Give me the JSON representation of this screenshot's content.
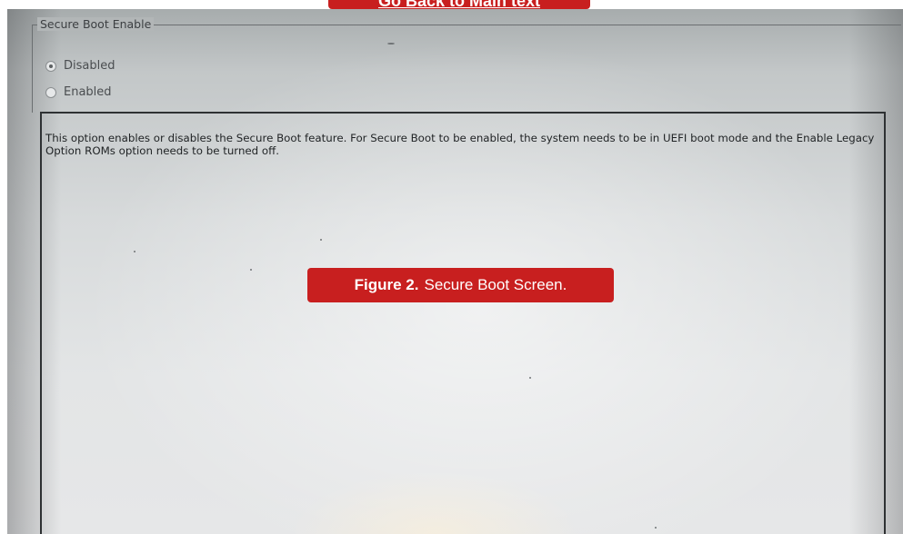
{
  "top_link": {
    "text": "Go Back to Main text"
  },
  "caption": {
    "label": "Figure 2.",
    "text": "Secure Boot Screen."
  },
  "secure_boot": {
    "title": "Secure Boot Enable",
    "options": [
      {
        "label": "Disabled",
        "selected": true
      },
      {
        "label": "Enabled",
        "selected": false
      }
    ]
  },
  "help": {
    "text": "This option enables or disables the Secure Boot feature. For Secure Boot to be enabled, the system needs to be in UEFI boot mode and the Enable Legacy Option ROMs option needs to be turned off."
  },
  "colors": {
    "accent": "#c81f1f",
    "screen": "#dcdfe0",
    "text": "#1f2224"
  }
}
